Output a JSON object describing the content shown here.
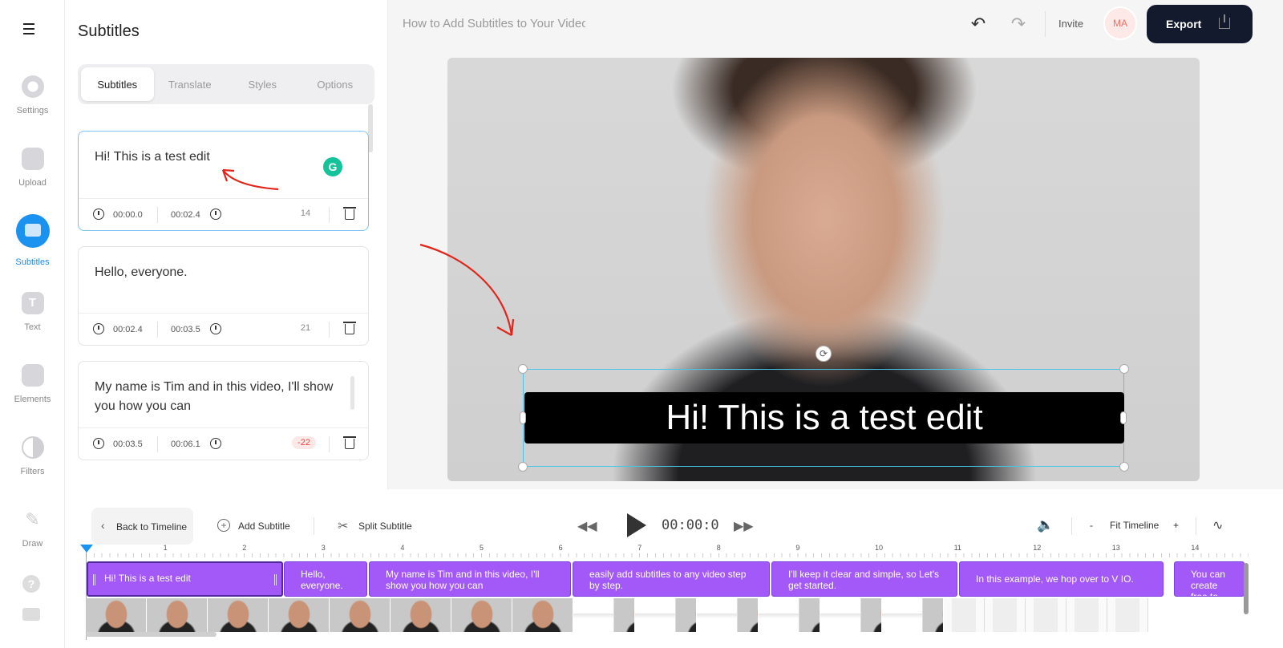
{
  "app": {
    "doc_title": "How to Add Subtitles to Your Video",
    "invite_label": "Invite",
    "avatar_initials": "MA",
    "export_label": "Export",
    "accent_color": "#1a92f0",
    "segment_color": "#a259f7"
  },
  "rail": {
    "items": [
      {
        "label": "Settings",
        "icon": "gear-icon"
      },
      {
        "label": "Upload",
        "icon": "image-upload-icon"
      },
      {
        "label": "Subtitles",
        "icon": "subtitles-icon",
        "active": true
      },
      {
        "label": "Text",
        "icon": "text-icon"
      },
      {
        "label": "Elements",
        "icon": "elements-icon"
      },
      {
        "label": "Filters",
        "icon": "filters-icon"
      },
      {
        "label": "Draw",
        "icon": "pencil-icon"
      }
    ]
  },
  "panel": {
    "title": "Subtitles",
    "tabs": [
      "Subtitles",
      "Translate",
      "Styles",
      "Options"
    ],
    "active_tab": "Subtitles",
    "cards": [
      {
        "text": "Hi! This is a test edit",
        "start": "00:00.0",
        "end": "00:02.4",
        "count": "14"
      },
      {
        "text": "Hello, everyone.",
        "start": "00:02.4",
        "end": "00:03.5",
        "count": "21"
      },
      {
        "text": "My name is Tim and in this video, I'll show you how you can",
        "start": "00:03.5",
        "end": "00:06.1",
        "count": "-22"
      }
    ]
  },
  "video": {
    "subtitle_text": "Hi! This is a test edit"
  },
  "timeline": {
    "back_label": "Back to Timeline",
    "add_subtitle_label": "Add Subtitle",
    "split_subtitle_label": "Split Subtitle",
    "timecode": "00:00:0",
    "zoom_minus": "-",
    "fit_label": "Fit Timeline",
    "zoom_plus": "+",
    "ruler_numbers": [
      "1",
      "2",
      "3",
      "4",
      "5",
      "6",
      "7",
      "8",
      "9",
      "10",
      "11",
      "12",
      "13",
      "14"
    ],
    "segments": [
      "Hi! This is a test edit",
      "Hello, everyone.",
      "My name is Tim and in this video, I'll show you how you can",
      "easily add subtitles to any video step by step.",
      "I'll keep it clear and simple, so Let's get started.",
      "In this example, we hop over to V IO.",
      "You can create free to go st"
    ]
  }
}
